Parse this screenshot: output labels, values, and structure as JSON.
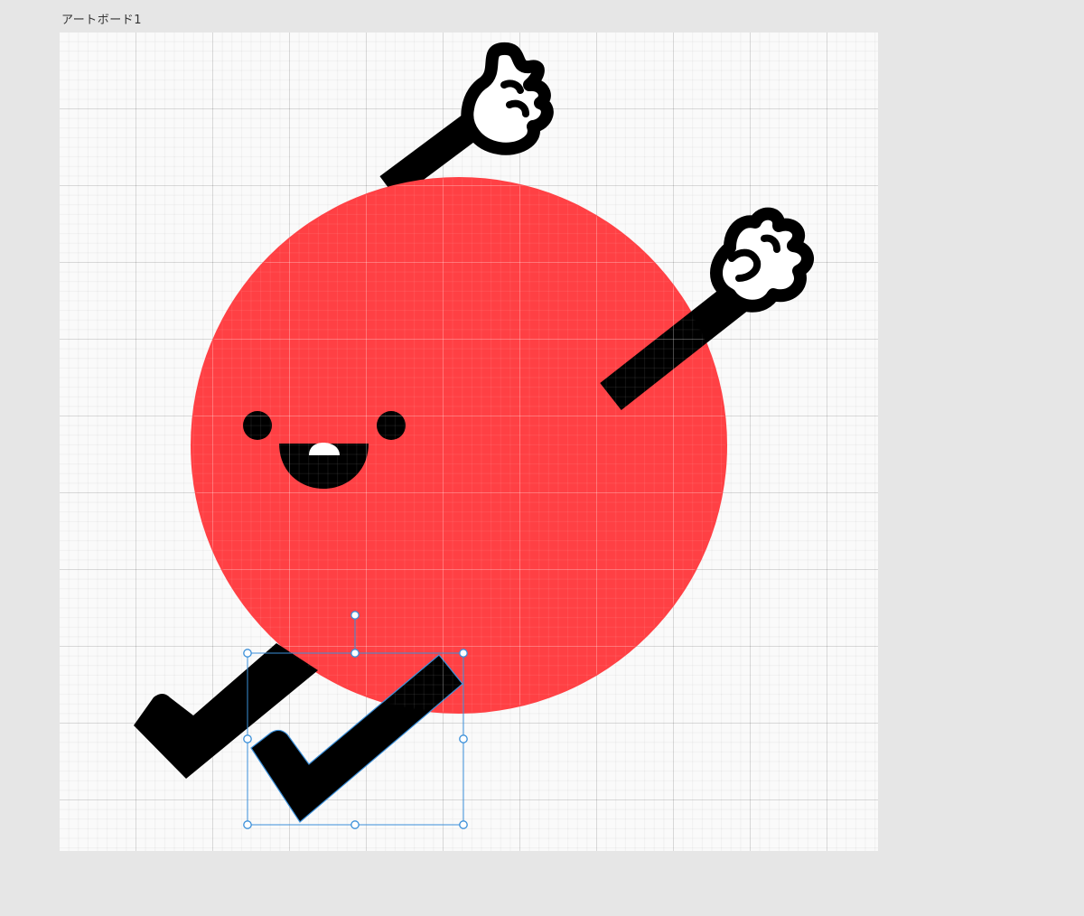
{
  "artboard": {
    "label": "アートボード1"
  },
  "colors": {
    "canvas_background": "#e6e6e6",
    "artboard_background": "#fafafa",
    "character_body": "#ff4044",
    "character_ink": "#000000",
    "selection_accent": "#3a8fd9"
  },
  "artwork": {
    "elements": [
      "body-circle",
      "left-eye",
      "right-eye",
      "smiling-mouth",
      "tooth",
      "upper-arm",
      "upper-hand",
      "right-arm",
      "right-hand",
      "back-leg",
      "front-leg-checkmark"
    ]
  },
  "selection": {
    "selected_element": "front-leg-checkmark",
    "handles": [
      "rotate",
      "top-left",
      "top-center",
      "top-right",
      "middle-left",
      "middle-right",
      "bottom-left",
      "bottom-center",
      "bottom-right"
    ]
  }
}
